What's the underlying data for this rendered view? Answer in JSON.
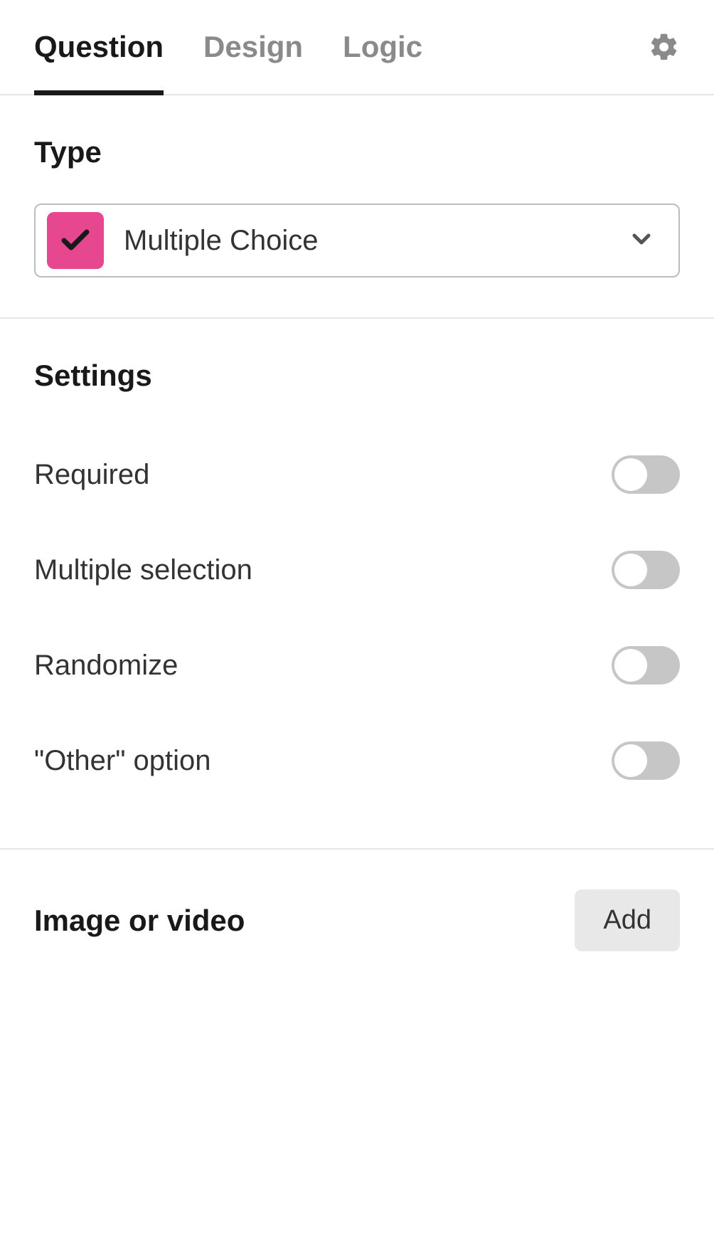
{
  "tabs": {
    "question": "Question",
    "design": "Design",
    "logic": "Logic"
  },
  "type": {
    "heading": "Type",
    "selected": "Multiple Choice"
  },
  "settings": {
    "heading": "Settings",
    "required": "Required",
    "multiple_selection": "Multiple selection",
    "randomize": "Randomize",
    "other_option": "\"Other\" option"
  },
  "image_section": {
    "heading": "Image or video",
    "add_label": "Add"
  }
}
